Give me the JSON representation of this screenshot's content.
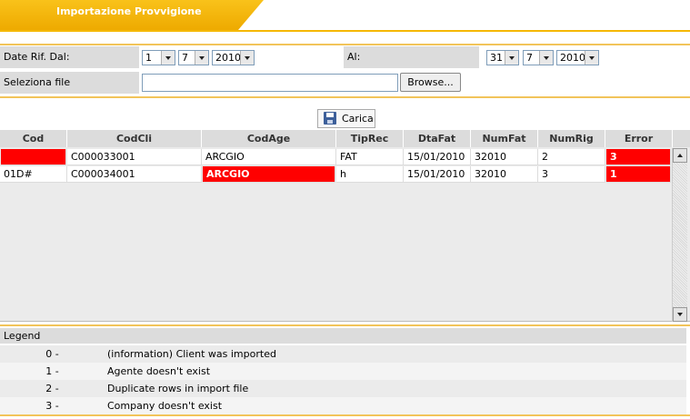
{
  "header": {
    "title": "Importazione Provvigione"
  },
  "colors": {
    "accent": "#f5b800",
    "error": "#ff0000"
  },
  "form": {
    "date_from_label": "Date Rif. Dal:",
    "date_from": {
      "day": "1",
      "month": "7",
      "year": "2010"
    },
    "date_to_label": "Al:",
    "date_to": {
      "day": "31",
      "month": "7",
      "year": "2010"
    },
    "file_label": "Seleziona file",
    "file_value": "",
    "browse_label": "Browse..."
  },
  "carica": {
    "label": "Carica",
    "icon": "floppy-disk-icon"
  },
  "grid": {
    "columns": [
      "Cod",
      "CodCli",
      "CodAge",
      "TipRec",
      "DtaFat",
      "NumFat",
      "NumRig",
      "Error"
    ],
    "rows": [
      [
        "",
        "C000033001",
        "ARCGIO",
        "FAT",
        "15/01/2010",
        "32010",
        "2",
        "3"
      ],
      [
        "01D#",
        "C000034001",
        "ARCGIO",
        "h",
        "15/01/2010",
        "32010",
        "3",
        "1"
      ]
    ]
  },
  "legend": {
    "title": "Legend",
    "items": [
      {
        "code": "0 -",
        "desc": "(information) Client was imported"
      },
      {
        "code": "1 -",
        "desc": "Agente doesn't exist"
      },
      {
        "code": "2 -",
        "desc": "Duplicate rows in import file"
      },
      {
        "code": "3 -",
        "desc": "Company doesn't exist"
      }
    ]
  }
}
